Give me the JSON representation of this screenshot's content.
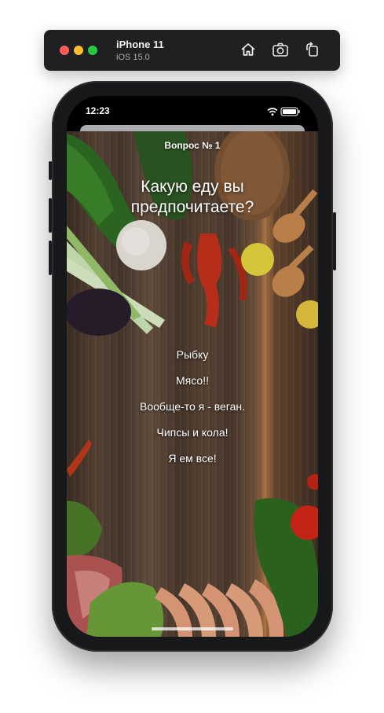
{
  "simulator": {
    "device_name": "iPhone 11",
    "os_version": "iOS 15.0",
    "buttons": [
      {
        "icon": "home-icon"
      },
      {
        "icon": "screenshot-icon"
      },
      {
        "icon": "rotate-icon"
      }
    ]
  },
  "status_bar": {
    "time": "12:23",
    "icons": [
      "wifi-icon",
      "battery-icon"
    ]
  },
  "quiz": {
    "question_number": "Вопрос № 1",
    "question": "Какую еду вы предпочитаете?",
    "answers": [
      "Рыбку",
      "Мясо!!",
      "Вообще-то я - веган.",
      "Чипсы и кола!",
      "Я ем все!"
    ]
  },
  "colors": {
    "toolbar_background": "#1e2022",
    "device_frame": "#17181a",
    "text": "#ffffff"
  }
}
